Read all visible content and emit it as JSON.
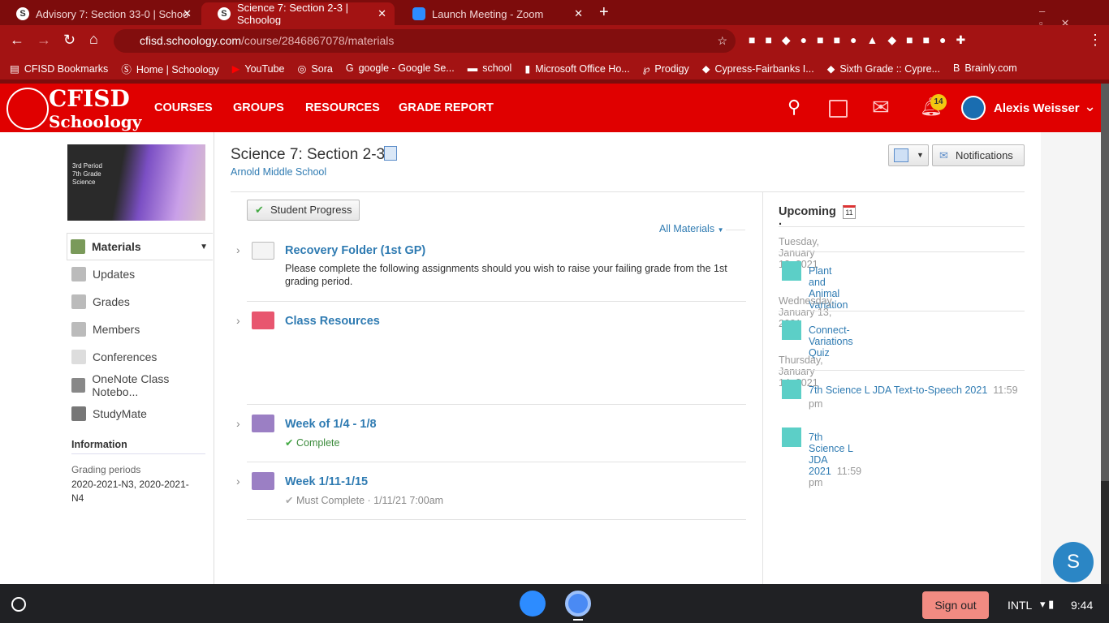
{
  "browser": {
    "tabs": [
      {
        "title": "Advisory 7: Section 33-0 | Schoo",
        "icon": "S"
      },
      {
        "title": "Science 7: Section 2-3 | Schoolog",
        "icon": "S"
      },
      {
        "title": "Launch Meeting - Zoom",
        "icon": "zoom"
      }
    ],
    "url_host": "cfisd.schoology.com",
    "url_path": "/course/2846867078/materials",
    "bookmarks": [
      "CFISD Bookmarks",
      "Home | Schoology",
      "YouTube",
      "Sora",
      "google - Google Se...",
      "school",
      "Microsoft Office Ho...",
      "Prodigy",
      "Cypress-Fairbanks I...",
      "Sixth Grade :: Cypre...",
      "Brainly.com"
    ]
  },
  "header": {
    "logo": "CFISD Schoology",
    "nav": [
      "COURSES",
      "GROUPS",
      "RESOURCES",
      "GRADE REPORT"
    ],
    "notif_count": "14",
    "user": "Alexis Weisser"
  },
  "course": {
    "banner_text": [
      "3rd Period",
      "7th Grade",
      "Science"
    ],
    "title": "Science 7: Section 2-3",
    "school": "Arnold Middle School",
    "notifications_label": "Notifications",
    "student_progress": "Student Progress",
    "filter": "All Materials"
  },
  "sidebar": {
    "items": [
      "Materials",
      "Updates",
      "Grades",
      "Members",
      "Conferences",
      "OneNote Class Notebo...",
      "StudyMate"
    ],
    "info_heading": "Information",
    "grading_label": "Grading periods",
    "grading_value": "2020-2021-N3, 2020-2021-N4"
  },
  "materials": [
    {
      "title": "Recovery Folder (1st GP)",
      "desc": "Please complete the following assignments should you wish to raise your failing grade from the 1st grading period.",
      "color": "#f2f2f2"
    },
    {
      "title": "Class Resources",
      "color": "#e8566f"
    },
    {
      "title": "Week of 1/4 - 1/8",
      "status": "Complete",
      "color": "#9b7fc4"
    },
    {
      "title": "Week 1/11-1/15",
      "status": "Must Complete · 1/11/21 7:00am",
      "color": "#9b7fc4"
    }
  ],
  "upcoming": {
    "heading": "Upcoming ·",
    "cal_day": "11",
    "groups": [
      {
        "date": "Tuesday, January 12, 2021",
        "items": [
          {
            "title": "Plant and Animal Variation",
            "time": ""
          }
        ]
      },
      {
        "date": "Wednesday, January 13, 2021",
        "items": [
          {
            "title": "Connect- Variations Quiz",
            "time": ""
          }
        ]
      },
      {
        "date": "Thursday, January 14, 2021",
        "items": [
          {
            "title": "7th Science L JDA Text-to-Speech 2021",
            "time": "11:59 pm"
          },
          {
            "title": "7th Science L JDA 2021",
            "time": "11:59 pm"
          }
        ]
      }
    ]
  },
  "chat_avatar": "S",
  "taskbar": {
    "sign_out": "Sign out",
    "locale": "INTL",
    "time": "9:44"
  }
}
